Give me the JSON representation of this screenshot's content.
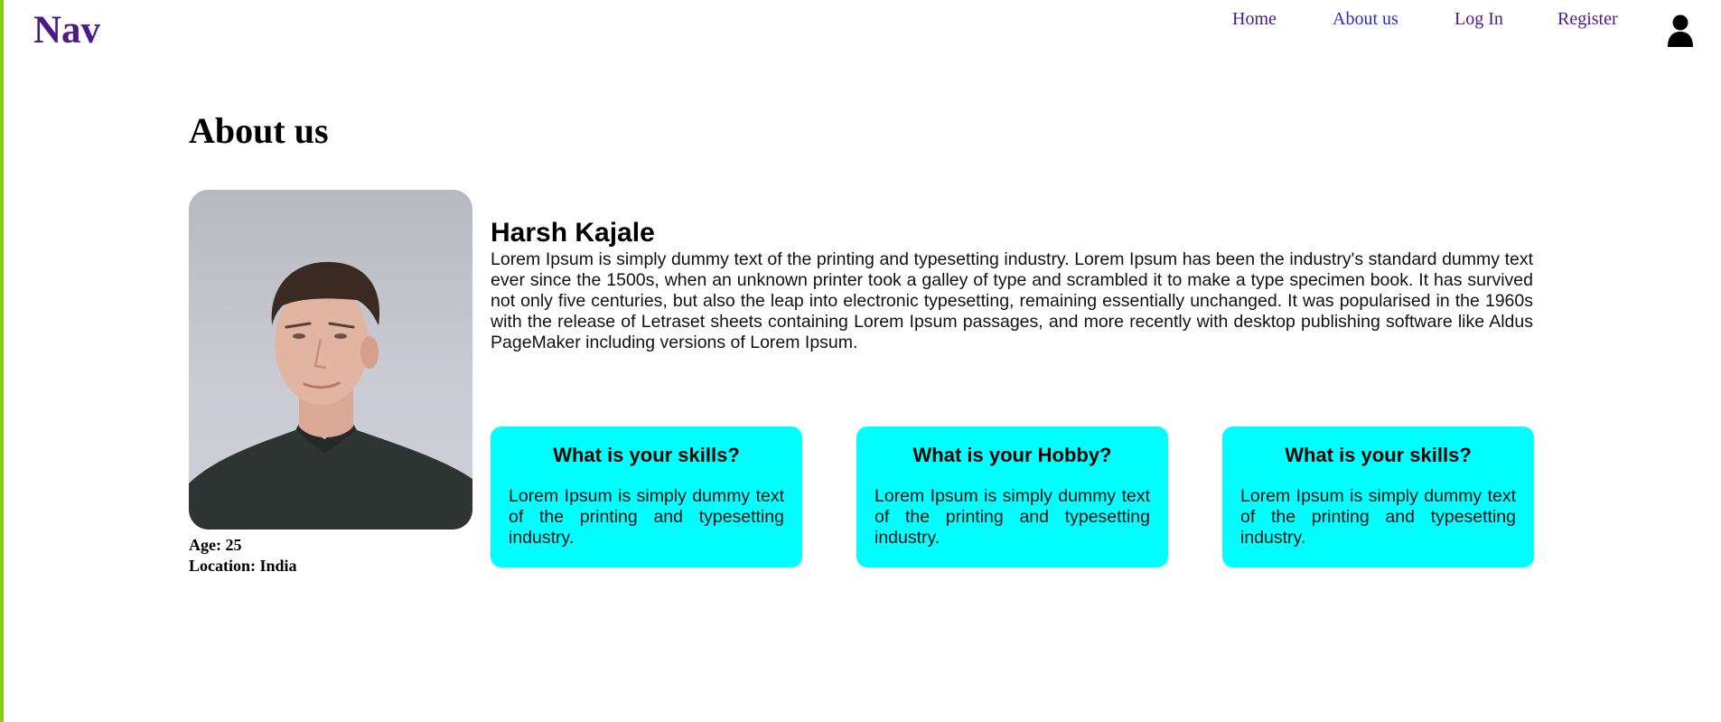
{
  "nav": {
    "logo": "Nav",
    "links": [
      {
        "label": "Home"
      },
      {
        "label": "About us"
      },
      {
        "label": "Log In"
      },
      {
        "label": "Register"
      }
    ],
    "user_icon": "user-icon"
  },
  "page": {
    "title": "About us"
  },
  "profile": {
    "photo_icon": "portrait-photo",
    "age_label": "Age: 25",
    "location_label": "Location: India",
    "name": "Harsh Kajale",
    "bio": "Lorem Ipsum is simply dummy text of the printing and typesetting industry. Lorem Ipsum has been the industry's standard dummy text ever since the 1500s, when an unknown printer took a galley of type and scrambled it to make a type specimen book. It has survived not only five centuries, but also the leap into electronic typesetting, remaining essentially unchanged. It was popularised in the 1960s with the release of Letraset sheets containing Lorem Ipsum passages, and more recently with desktop publishing software like Aldus PageMaker including versions of Lorem Ipsum."
  },
  "cards": [
    {
      "title": "What is your skills?",
      "body": "Lorem Ipsum is simply dummy text of the printing and typesetting industry."
    },
    {
      "title": "What is your Hobby?",
      "body": "Lorem Ipsum is simply dummy text of the printing and typesetting industry."
    },
    {
      "title": "What is your skills?",
      "body": "Lorem Ipsum is simply dummy text of the printing and typesetting industry."
    }
  ],
  "colors": {
    "brand": "#4a1a86",
    "active_link": "#2b2bd6",
    "card_bg": "#00ffff",
    "left_edge": "#84cc16"
  }
}
